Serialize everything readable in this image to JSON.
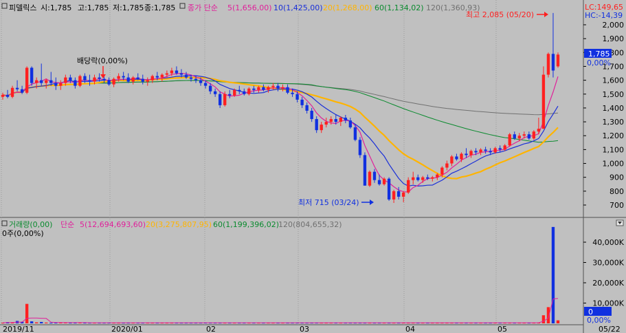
{
  "stock": {
    "name": "피델릭스",
    "open_label": "시:1,785",
    "high_label": "고:1,785",
    "low_label": "저:1,785",
    "close_label": "종:1,785"
  },
  "price_legend": [
    {
      "label": "종가 단순",
      "color": "#e0209a"
    },
    {
      "label": "5(1,656,00)",
      "color": "#e0209a"
    },
    {
      "label": "10(1,425,00)",
      "color": "#1a2fd8"
    },
    {
      "label": "20(1,268,00)",
      "color": "#ffb400"
    },
    {
      "label": "60(1,134,02)",
      "color": "#0a8a2e"
    },
    {
      "label": "120(1,360,93)",
      "color": "#707070"
    }
  ],
  "volume_legend": [
    {
      "label": "거래량(0,00)",
      "color": "#0a8a2e"
    },
    {
      "label": "단순",
      "color": "#e0209a"
    },
    {
      "label": "5(12,694,693,60)",
      "color": "#e0209a"
    },
    {
      "label": "20(3,275,807,95)",
      "color": "#ffb400"
    },
    {
      "label": "60(1,199,396,02)",
      "color": "#0a8a2e"
    },
    {
      "label": "120(804,655,32)",
      "color": "#707070"
    }
  ],
  "volume_info": "0주(0,00%)",
  "annotations": {
    "high": "최고 2,085 (05/20)",
    "low": "최저 715 (03/24)",
    "dividend": "배당락(0,00%)"
  },
  "right_panel": {
    "lc": "LC:149,65",
    "hc": "HC:-14,39",
    "price_box": "1,785",
    "price_pct": "0,00%",
    "vol_box": "0",
    "vol_pct": "0,00%"
  },
  "colors": {
    "up": "#ff2020",
    "down": "#1030e0",
    "ma5": "#e0209a",
    "ma10": "#1a2fd8",
    "ma20": "#ffb400",
    "ma60": "#0a8a2e",
    "ma120": "#707070"
  },
  "chart_data": {
    "type": "candlestick",
    "price_axis": {
      "ticks": [
        700,
        800,
        900,
        1000,
        1100,
        1200,
        1300,
        1400,
        1500,
        1600,
        1700,
        1800,
        1900,
        2000
      ],
      "tick_labels": [
        "700",
        "800",
        "900",
        "1,000",
        "1,100",
        "1,200",
        "1,300",
        "1,400",
        "1,500",
        "1,600",
        "1,700",
        "1,800",
        "1,900",
        "2,000"
      ]
    },
    "volume_axis": {
      "ticks": [
        10000,
        20000,
        30000,
        40000
      ],
      "tick_labels": [
        "10,000K",
        "20,000K",
        "30,000K",
        "40,000K"
      ]
    },
    "x_axis_labels": [
      "2019/11",
      "2020/01",
      "02",
      "03",
      "04",
      "05",
      "05/22"
    ],
    "candles": [
      [
        1480,
        1510,
        1460,
        1495
      ],
      [
        1495,
        1530,
        1470,
        1480
      ],
      [
        1480,
        1560,
        1470,
        1545
      ],
      [
        1545,
        1600,
        1520,
        1535
      ],
      [
        1535,
        1560,
        1500,
        1510
      ],
      [
        1510,
        1700,
        1500,
        1690
      ],
      [
        1690,
        1700,
        1560,
        1580
      ],
      [
        1580,
        1620,
        1540,
        1600
      ],
      [
        1600,
        1720,
        1560,
        1580
      ],
      [
        1580,
        1610,
        1540,
        1600
      ],
      [
        1600,
        1660,
        1560,
        1580
      ],
      [
        1580,
        1620,
        1530,
        1560
      ],
      [
        1560,
        1600,
        1530,
        1580
      ],
      [
        1580,
        1640,
        1560,
        1620
      ],
      [
        1620,
        1640,
        1580,
        1600
      ],
      [
        1600,
        1620,
        1540,
        1560
      ],
      [
        1560,
        1640,
        1550,
        1630
      ],
      [
        1630,
        1650,
        1580,
        1600
      ],
      [
        1600,
        1640,
        1560,
        1590
      ],
      [
        1590,
        1640,
        1570,
        1620
      ],
      [
        1620,
        1650,
        1590,
        1610
      ],
      [
        1610,
        1640,
        1580,
        1600
      ],
      [
        1600,
        1620,
        1560,
        1570
      ],
      [
        1570,
        1620,
        1550,
        1610
      ],
      [
        1610,
        1650,
        1590,
        1630
      ],
      [
        1630,
        1660,
        1600,
        1620
      ],
      [
        1620,
        1650,
        1580,
        1590
      ],
      [
        1590,
        1630,
        1570,
        1620
      ],
      [
        1620,
        1650,
        1600,
        1610
      ],
      [
        1610,
        1640,
        1570,
        1590
      ],
      [
        1590,
        1620,
        1560,
        1600
      ],
      [
        1600,
        1640,
        1580,
        1630
      ],
      [
        1630,
        1660,
        1600,
        1620
      ],
      [
        1620,
        1650,
        1590,
        1640
      ],
      [
        1640,
        1670,
        1620,
        1650
      ],
      [
        1650,
        1690,
        1630,
        1670
      ],
      [
        1670,
        1700,
        1640,
        1650
      ],
      [
        1650,
        1680,
        1620,
        1640
      ],
      [
        1640,
        1660,
        1610,
        1620
      ],
      [
        1620,
        1640,
        1590,
        1610
      ],
      [
        1610,
        1630,
        1580,
        1600
      ],
      [
        1600,
        1620,
        1560,
        1580
      ],
      [
        1580,
        1600,
        1540,
        1560
      ],
      [
        1560,
        1580,
        1500,
        1520
      ],
      [
        1520,
        1540,
        1480,
        1500
      ],
      [
        1500,
        1520,
        1400,
        1420
      ],
      [
        1420,
        1520,
        1410,
        1500
      ],
      [
        1500,
        1530,
        1470,
        1490
      ],
      [
        1490,
        1540,
        1480,
        1530
      ],
      [
        1530,
        1560,
        1500,
        1520
      ],
      [
        1520,
        1540,
        1490,
        1500
      ],
      [
        1500,
        1550,
        1490,
        1540
      ],
      [
        1540,
        1560,
        1510,
        1530
      ],
      [
        1530,
        1560,
        1510,
        1550
      ],
      [
        1550,
        1570,
        1520,
        1530
      ],
      [
        1530,
        1560,
        1510,
        1550
      ],
      [
        1550,
        1580,
        1530,
        1560
      ],
      [
        1560,
        1580,
        1520,
        1540
      ],
      [
        1540,
        1570,
        1520,
        1550
      ],
      [
        1550,
        1570,
        1500,
        1510
      ],
      [
        1510,
        1540,
        1480,
        1500
      ],
      [
        1500,
        1520,
        1440,
        1460
      ],
      [
        1460,
        1480,
        1400,
        1420
      ],
      [
        1420,
        1440,
        1360,
        1380
      ],
      [
        1380,
        1400,
        1300,
        1320
      ],
      [
        1320,
        1340,
        1220,
        1240
      ],
      [
        1240,
        1300,
        1220,
        1280
      ],
      [
        1280,
        1330,
        1260,
        1300
      ],
      [
        1300,
        1340,
        1280,
        1320
      ],
      [
        1320,
        1350,
        1280,
        1300
      ],
      [
        1300,
        1340,
        1270,
        1330
      ],
      [
        1330,
        1350,
        1290,
        1310
      ],
      [
        1310,
        1330,
        1250,
        1260
      ],
      [
        1260,
        1280,
        1160,
        1170
      ],
      [
        1170,
        1190,
        1040,
        1060
      ],
      [
        1060,
        1080,
        840,
        840
      ],
      [
        840,
        950,
        830,
        940
      ],
      [
        940,
        960,
        860,
        880
      ],
      [
        880,
        920,
        840,
        850
      ],
      [
        850,
        900,
        840,
        890
      ],
      [
        890,
        900,
        730,
        740
      ],
      [
        740,
        810,
        715,
        800
      ],
      [
        800,
        830,
        740,
        760
      ],
      [
        760,
        800,
        720,
        790
      ],
      [
        790,
        900,
        780,
        880
      ],
      [
        880,
        940,
        850,
        900
      ],
      [
        900,
        920,
        870,
        880
      ],
      [
        880,
        910,
        860,
        900
      ],
      [
        900,
        920,
        880,
        890
      ],
      [
        890,
        910,
        870,
        900
      ],
      [
        900,
        930,
        880,
        920
      ],
      [
        920,
        980,
        900,
        970
      ],
      [
        970,
        1020,
        950,
        1000
      ],
      [
        1000,
        1060,
        980,
        1050
      ],
      [
        1050,
        1070,
        1020,
        1030
      ],
      [
        1030,
        1080,
        1010,
        1070
      ],
      [
        1070,
        1110,
        1040,
        1060
      ],
      [
        1060,
        1100,
        1040,
        1090
      ],
      [
        1090,
        1110,
        1060,
        1080
      ],
      [
        1080,
        1110,
        1060,
        1100
      ],
      [
        1100,
        1120,
        1070,
        1090
      ],
      [
        1090,
        1110,
        1060,
        1080
      ],
      [
        1080,
        1120,
        1070,
        1110
      ],
      [
        1110,
        1130,
        1080,
        1100
      ],
      [
        1100,
        1140,
        1090,
        1130
      ],
      [
        1130,
        1220,
        1120,
        1210
      ],
      [
        1210,
        1230,
        1170,
        1180
      ],
      [
        1180,
        1220,
        1160,
        1200
      ],
      [
        1200,
        1230,
        1180,
        1210
      ],
      [
        1210,
        1230,
        1170,
        1180
      ],
      [
        1180,
        1240,
        1170,
        1230
      ],
      [
        1230,
        1330,
        1210,
        1250
      ],
      [
        1250,
        1700,
        1250,
        1640
      ],
      [
        1640,
        1800,
        1620,
        1790
      ],
      [
        1790,
        2085,
        1620,
        1670
      ],
      [
        1700,
        1800,
        1690,
        1785
      ]
    ],
    "volume": [
      0.3,
      0.6,
      0.4,
      1.2,
      0.8,
      9.6,
      1.0,
      0.5,
      0.7,
      0.4,
      0.3,
      0.3,
      0.4,
      0.5,
      0.3,
      0.3,
      0.4,
      0.3,
      0.3,
      0.3,
      0.3,
      0.3,
      0.3,
      0.3,
      0.3,
      0.3,
      0.3,
      0.3,
      0.3,
      0.3,
      0.3,
      0.3,
      0.3,
      0.3,
      0.3,
      0.3,
      0.3,
      0.3,
      0.3,
      0.3,
      0.3,
      0.3,
      0.3,
      0.3,
      0.3,
      0.3,
      0.3,
      0.3,
      0.3,
      0.3,
      0.3,
      0.3,
      0.3,
      0.3,
      0.3,
      0.3,
      0.3,
      0.3,
      0.3,
      0.3,
      0.3,
      0.3,
      0.3,
      0.3,
      0.3,
      0.3,
      0.3,
      0.3,
      0.3,
      0.3,
      0.3,
      0.3,
      0.3,
      0.3,
      0.3,
      0.3,
      0.3,
      0.3,
      0.3,
      0.3,
      0.3,
      0.3,
      0.3,
      0.3,
      0.3,
      0.3,
      0.3,
      0.3,
      0.3,
      0.3,
      0.3,
      0.3,
      0.3,
      0.3,
      0.3,
      0.3,
      0.3,
      0.3,
      0.3,
      0.3,
      0.3,
      0.3,
      0.3,
      0.3,
      0.3,
      0.3,
      0.3,
      0.3,
      0.3,
      0.3,
      0.3,
      0.3,
      4.0,
      8.0,
      47.5,
      1.5
    ],
    "volume_unit": "M"
  }
}
